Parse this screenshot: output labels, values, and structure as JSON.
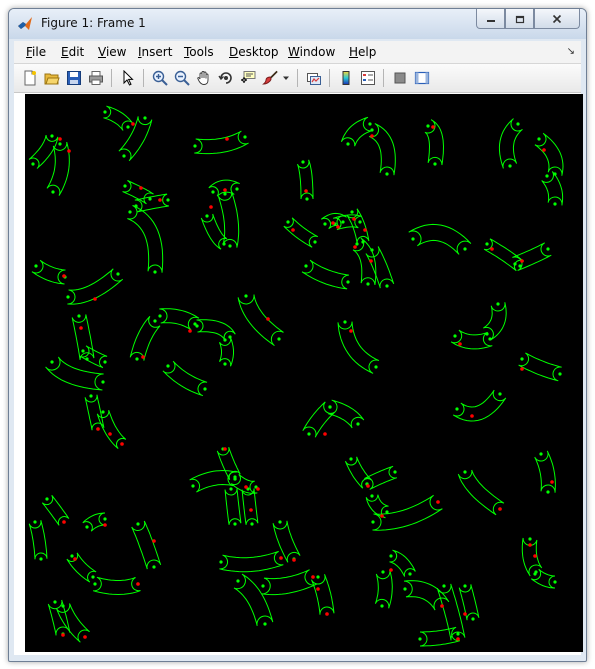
{
  "window": {
    "title": "Figure 1:  Frame 1"
  },
  "menu": [
    {
      "name": "file",
      "label": "File",
      "u": "F",
      "rest": "ile"
    },
    {
      "name": "edit",
      "label": "Edit",
      "u": "E",
      "rest": "dit"
    },
    {
      "name": "view",
      "label": "View",
      "u": "V",
      "rest": "iew"
    },
    {
      "name": "insert",
      "label": "Insert",
      "u": "I",
      "rest": "nsert"
    },
    {
      "name": "tools",
      "label": "Tools",
      "u": "T",
      "rest": "ools"
    },
    {
      "name": "desktop",
      "label": "Desktop",
      "u": "D",
      "rest": "esktop"
    },
    {
      "name": "window",
      "label": "Window",
      "u": "W",
      "rest": "indow"
    },
    {
      "name": "help",
      "label": "Help",
      "u": "H",
      "rest": "elp"
    }
  ],
  "toolbar_icons": [
    "new-figure-icon",
    "open-file-icon",
    "save-icon",
    "print-icon",
    "select-arrow-icon",
    "zoom-in-icon",
    "zoom-out-icon",
    "pan-hand-icon",
    "rotate-3d-icon",
    "data-cursor-icon",
    "brush-icon",
    "link-plot-icon",
    "colorbar-icon",
    "legend-icon",
    "hide-plot-tools-icon",
    "show-plot-tools-icon"
  ],
  "colors": {
    "outline": "#00ff00",
    "marker": "#ff0000",
    "background": "#000000"
  }
}
